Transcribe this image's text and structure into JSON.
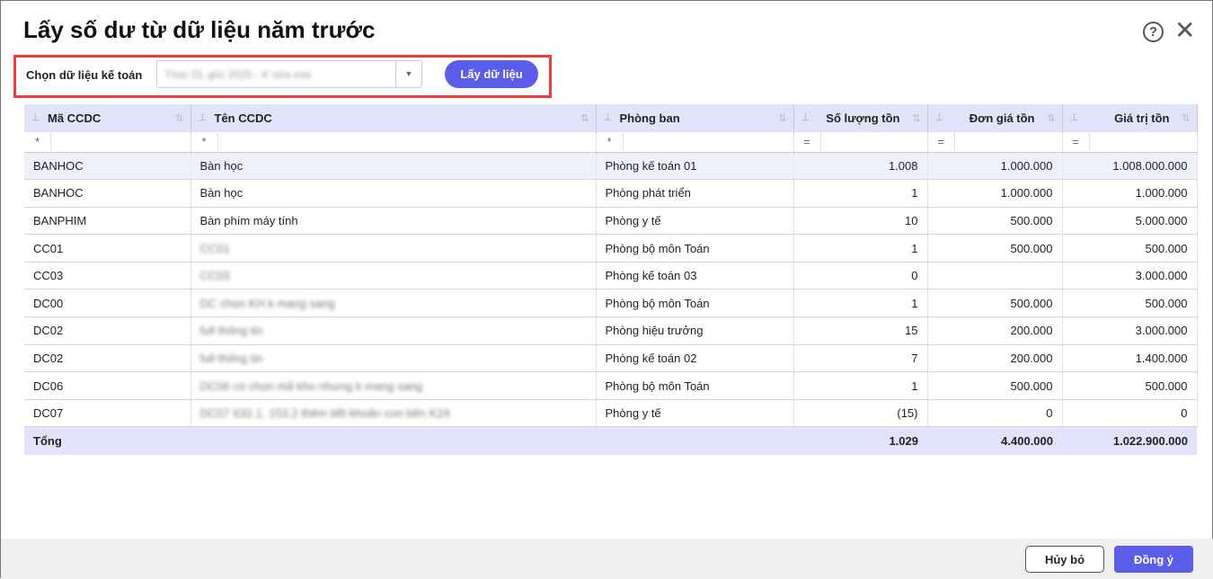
{
  "title": "Lấy số dư từ dữ liệu năm trước",
  "toolbar": {
    "label": "Chọn dữ liệu kế toán",
    "select_value": "Thuc DL gốc 2025 - K sửa xóa",
    "get_button": "Lấy dữ liệu"
  },
  "columns": [
    {
      "label": "Mã CCDC",
      "filter": "*"
    },
    {
      "label": "Tên CCDC",
      "filter": "*"
    },
    {
      "label": "Phòng ban",
      "filter": "*"
    },
    {
      "label": "Số lượng tồn",
      "filter": "="
    },
    {
      "label": "Đơn giá tồn",
      "filter": "="
    },
    {
      "label": "Giá trị tồn",
      "filter": "="
    }
  ],
  "rows": [
    [
      "BANHOC",
      "Bàn học",
      "Phòng kế toán 01",
      "1.008",
      "1.000.000",
      "1.008.000.000"
    ],
    [
      "BANHOC",
      "Bàn học",
      "Phòng phát triển",
      "1",
      "1.000.000",
      "1.000.000"
    ],
    [
      "BANPHIM",
      "Bàn phím máy tính",
      "Phòng y tế",
      "10",
      "500.000",
      "5.000.000"
    ],
    [
      "CC01",
      "CC01",
      "Phòng bộ môn Toán",
      "1",
      "500.000",
      "500.000"
    ],
    [
      "CC03",
      "CC03",
      "Phòng kế toán 03",
      "0",
      "",
      "3.000.000"
    ],
    [
      "DC00",
      "DC chọn KH k mang sang",
      "Phòng bộ môn Toán",
      "1",
      "500.000",
      "500.000"
    ],
    [
      "DC02",
      "full thông tin",
      "Phòng hiệu trưởng",
      "15",
      "200.000",
      "3.000.000"
    ],
    [
      "DC02",
      "full thông tin",
      "Phòng kế toán 02",
      "7",
      "200.000",
      "1.400.000"
    ],
    [
      "DC06",
      "DC06 có chọn mã kho nhưng k mang sang",
      "Phòng bộ môn Toán",
      "1",
      "500.000",
      "500.000"
    ],
    [
      "DC07",
      "DC07 632.1, 153.2 thêm tiết khoản con bên K24",
      "Phòng y tế",
      "(15)",
      "0",
      "0"
    ]
  ],
  "blurred_name_rows": [
    3,
    4,
    5,
    6,
    7,
    8,
    9
  ],
  "total": {
    "label": "Tổng",
    "qty": "1.029",
    "price": "4.400.000",
    "value": "1.022.900.000"
  },
  "footer": {
    "cancel": "Hủy bỏ",
    "ok": "Đồng ý"
  },
  "colors": {
    "accent": "#5b5ce8",
    "header_bg": "#e2e3fa",
    "highlight": "#ee3b3b"
  }
}
